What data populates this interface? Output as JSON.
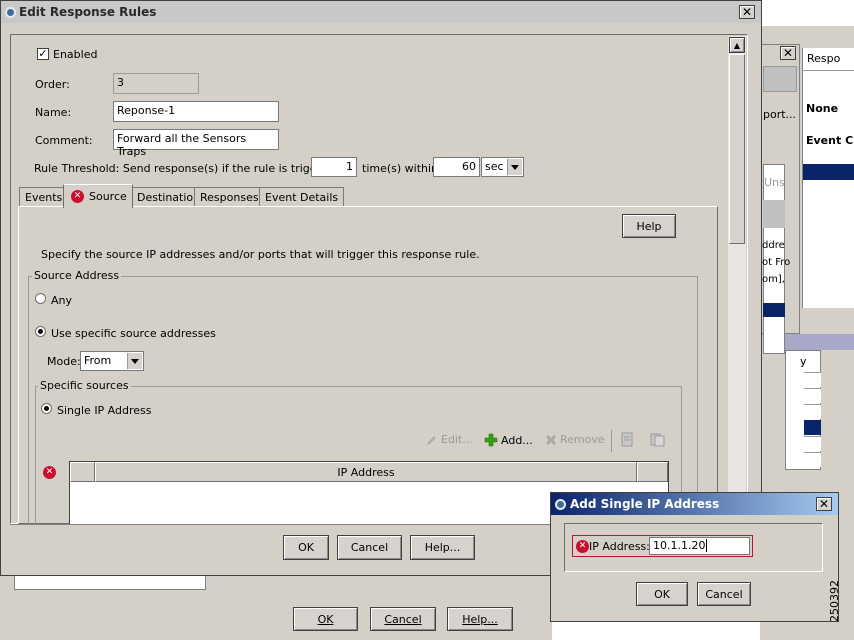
{
  "colors": {
    "titlebar_active": "#0a246a",
    "titlebar_gradient": "#a6caf0",
    "titlebar_inactive": "#808080",
    "dialog_bg": "#d4d0c8",
    "error_red": "#c8102e",
    "selection_blue": "#0a246a"
  },
  "background_window": {
    "labels": [
      "Respo",
      "port...",
      "None",
      "Event C",
      "Uns",
      "ddre",
      "ot Fro",
      "om],",
      "y"
    ],
    "footer_buttons": [
      "OK",
      "Cancel",
      "Help..."
    ]
  },
  "dialog": {
    "title": "Edit Response Rules",
    "enabled_label": "Enabled",
    "order_label": "Order:",
    "order_value": "3",
    "name_label": "Name:",
    "name_value": "Reponse-1",
    "comment_label": "Comment:",
    "comment_value": "Forward all the Sensors Traps",
    "threshold_prefix": "Rule Threshold: Send response(s) if the rule is triggered",
    "threshold_count": "1",
    "threshold_mid": "time(s) within",
    "threshold_time": "60",
    "threshold_unit": "sec",
    "tabs": [
      "Events",
      "Source",
      "Destination",
      "Responses",
      "Event Details"
    ],
    "help_button": "Help",
    "source_description": "Specify the source IP addresses and/or ports that will trigger this response rule.",
    "source_address_group": "Source Address",
    "any_label": "Any",
    "use_specific_label": "Use specific source addresses",
    "mode_label": "Mode:",
    "mode_value": "From",
    "specific_sources_group": "Specific sources",
    "single_ip_label": "Single IP Address",
    "toolbar": {
      "edit": "Edit...",
      "add": "Add...",
      "remove": "Remove"
    },
    "table_header": "IP Address",
    "ok": "OK",
    "cancel": "Cancel",
    "help": "Help..."
  },
  "popup": {
    "title": "Add Single IP Address",
    "ip_label": "IP Address:",
    "ip_value": "10.1.1.20",
    "ok": "OK",
    "cancel": "Cancel"
  },
  "figure_id": "250392"
}
